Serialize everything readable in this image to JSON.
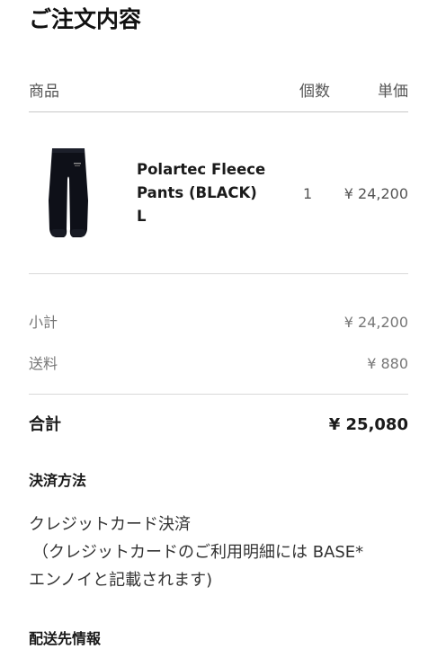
{
  "page": {
    "title": "ご注文内容"
  },
  "table_header": {
    "product": "商品",
    "quantity": "個数",
    "unit_price": "単価"
  },
  "item": {
    "thumbnail_icon": "fleece-pants-thumbnail",
    "name": "Polartec Fleece\nPants (BLACK)\nL",
    "quantity": "1",
    "price": "¥ 24,200"
  },
  "summary": {
    "subtotal_label": "小計",
    "subtotal_value": "¥ 24,200",
    "shipping_label": "送料",
    "shipping_value": "¥ 880",
    "total_label": "合計",
    "total_value": "¥ 25,080"
  },
  "payment": {
    "heading": "決済方法",
    "method": "クレジットカード決済",
    "note_line1": "（クレジットカードのご利用明細には BASE*",
    "note_line2": "エンノイと記載されます)"
  },
  "shipping_info": {
    "heading": "配送先情報"
  },
  "colors": {
    "divider": "#d9d9d9",
    "text_primary": "#1a1a1a",
    "text_muted": "#777777"
  }
}
